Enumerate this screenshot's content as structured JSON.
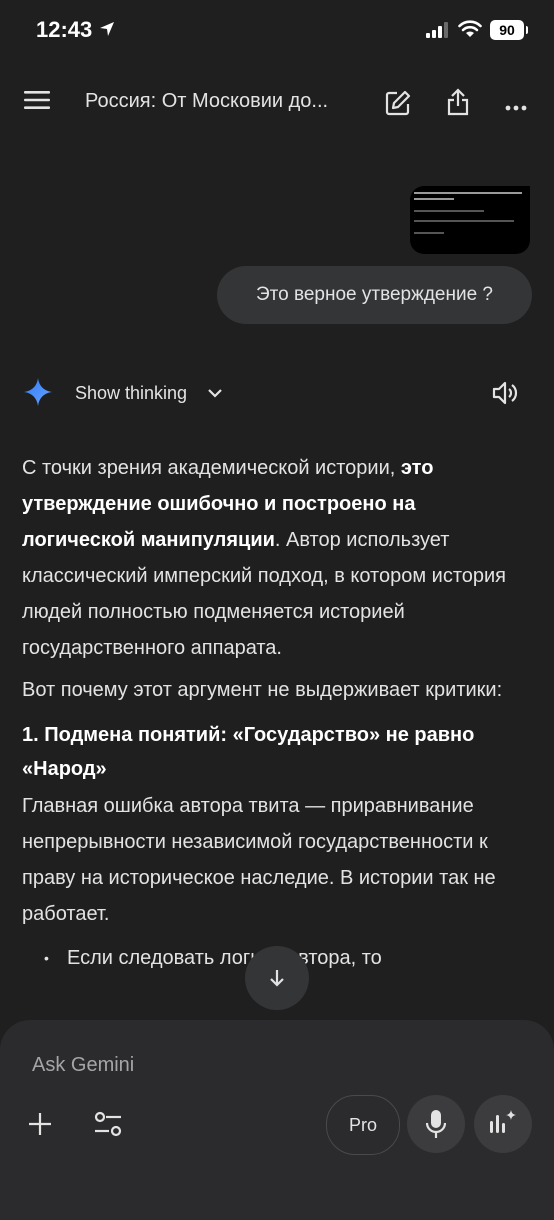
{
  "status_bar": {
    "time": "12:43",
    "battery": "90"
  },
  "header": {
    "title": "Россия: От Московии до..."
  },
  "conversation": {
    "user_message": "Это верное утверждение ?",
    "thinking_label": "Show thinking"
  },
  "answer": {
    "p1_start": "С точки зрения академической истории, ",
    "p1_bold": "это утверждение ошибочно и построено на логической манипуляции",
    "p1_end": ". Автор использует классический имперский подход, в котором история людей полностью подменяется историей государственного аппарата.",
    "p2": "Вот почему этот аргумент не выдерживает критики:",
    "heading1": "1. Подмена понятий: «Государство» не равно «Народ»",
    "p3": "Главная ошибка автора твита — приравнивание непрерывности независимой государственности к праву на историческое наследие. В истории так не работает.",
    "bullet1": "Если следовать логике автора, то"
  },
  "composer": {
    "placeholder": "Ask Gemini",
    "pro_label": "Pro"
  },
  "icons": {
    "menu": "menu-icon",
    "edit": "edit-icon",
    "share": "share-icon",
    "more": "more-icon",
    "gemini": "gemini-sparkle-icon",
    "chevron": "chevron-down-icon",
    "speaker": "speaker-icon",
    "scroll": "arrow-down-icon",
    "plus": "plus-icon",
    "tools": "tools-icon",
    "mic": "mic-icon",
    "live": "live-icon"
  },
  "colors": {
    "background": "#1f1f1f",
    "bubble": "#333537",
    "composer": "#2b2b2d",
    "gemini_blue": "#4b8df8"
  }
}
